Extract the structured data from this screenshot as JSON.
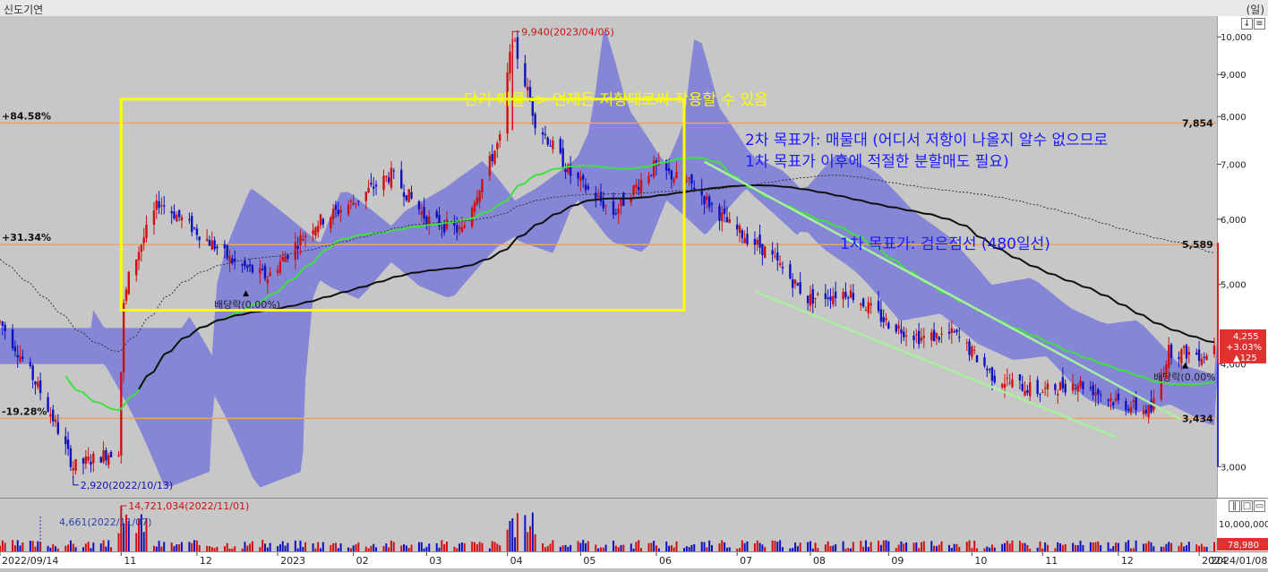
{
  "window": {
    "title": "신도기연",
    "unit": "(일)"
  },
  "chart_data": {
    "type": "candlestick",
    "period": "daily",
    "x_start": "2022/09/14",
    "x_end": "2024/01/08",
    "x_ticks": [
      "2022/09/14",
      "11",
      "12",
      "2023",
      "02",
      "03",
      "04",
      "05",
      "06",
      "07",
      "08",
      "09",
      "10",
      "11",
      "12",
      "2024",
      "2024/01/08"
    ],
    "y_ticks": [
      "3,000",
      "4,000",
      "5,000",
      "6,000",
      "7,000",
      "8,000",
      "9,000",
      "10,000"
    ],
    "y_scale": "log",
    "ylim": [
      2750,
      10600
    ],
    "price_trend": [
      [
        "2022/09/14",
        4500
      ],
      [
        "2022/09/30",
        3700
      ],
      [
        "2022/10/13",
        3000
      ],
      [
        "2022/10/31",
        3150
      ],
      [
        "2022/11/02",
        4700
      ],
      [
        "2022/11/04",
        5100
      ],
      [
        "2022/11/16",
        6300
      ],
      [
        "2022/12/01",
        5800
      ],
      [
        "2022/12/16",
        5300
      ],
      [
        "2022/12/29",
        5100
      ],
      [
        "2023/01/16",
        5900
      ],
      [
        "2023/02/01",
        6300
      ],
      [
        "2023/02/16",
        6800
      ],
      [
        "2023/03/02",
        6000
      ],
      [
        "2023/03/16",
        5800
      ],
      [
        "2023/03/31",
        7500
      ],
      [
        "2023/04/05",
        9940
      ],
      [
        "2023/04/14",
        7900
      ],
      [
        "2023/04/28",
        6800
      ],
      [
        "2023/05/15",
        6100
      ],
      [
        "2023/05/31",
        6950
      ],
      [
        "2023/06/15",
        6600
      ],
      [
        "2023/06/30",
        5900
      ],
      [
        "2023/07/14",
        5500
      ],
      [
        "2023/07/31",
        4800
      ],
      [
        "2023/08/16",
        4900
      ],
      [
        "2023/08/31",
        4500
      ],
      [
        "2023/09/14",
        4300
      ],
      [
        "2023/09/27",
        4350
      ],
      [
        "2023/10/13",
        3850
      ],
      [
        "2023/10/31",
        3700
      ],
      [
        "2023/11/15",
        3800
      ],
      [
        "2023/11/30",
        3600
      ],
      [
        "2023/12/14",
        3500
      ],
      [
        "2023/12/21",
        4150
      ],
      [
        "2024/01/05",
        4100
      ],
      [
        "2024/01/08",
        4255
      ]
    ],
    "horizontal_lines": [
      {
        "label": "+84.58%",
        "value": 7854,
        "value_label": "7,854",
        "color": "#f0a060"
      },
      {
        "label": "+31.34%",
        "value": 5589,
        "value_label": "5,589",
        "color": "#f0a060"
      },
      {
        "label": "-19.28%",
        "value": 3434,
        "value_label": "3,434",
        "color": "#f0a060"
      }
    ],
    "annotations": {
      "high": "9,940(2023/04/05)",
      "low": "2,920(2022/10/13)",
      "ex_div_1": "배당락(0.00%)",
      "ex_div_2": "배당락(0.00%)",
      "note_resistance": "단기 매물 -> 언제든 저항대로써 작용할 수 있음",
      "note_target1": "1차 목표가: 검은점선 (480일선)",
      "note_target2_line1": "2차 목표가: 매물대 (어디서 저항이 나올지 알수 없으므로",
      "note_target2_line2": "1차 목표가 이후에 적절한 분할매도 필요)"
    },
    "current": {
      "price": "4,255",
      "change_pct": "+3.03%",
      "change": "▲125"
    },
    "volume": {
      "y_ticks": [
        "10,000,000"
      ],
      "max_label": "14,721,034(2022/11/01)",
      "min_label": "4,661(2022/11/07)",
      "current": "78,980"
    },
    "colors": {
      "up": "#d01010",
      "down": "#1010c0",
      "ma_green": "#40e040",
      "ma_black": "#101010",
      "cloud": "#7a7ad8",
      "box": "#ffff00",
      "channel": "#a8f0a0",
      "note_yellow": "#ffff00",
      "note_blue": "#1a1aff",
      "circle": "#30e030"
    }
  }
}
